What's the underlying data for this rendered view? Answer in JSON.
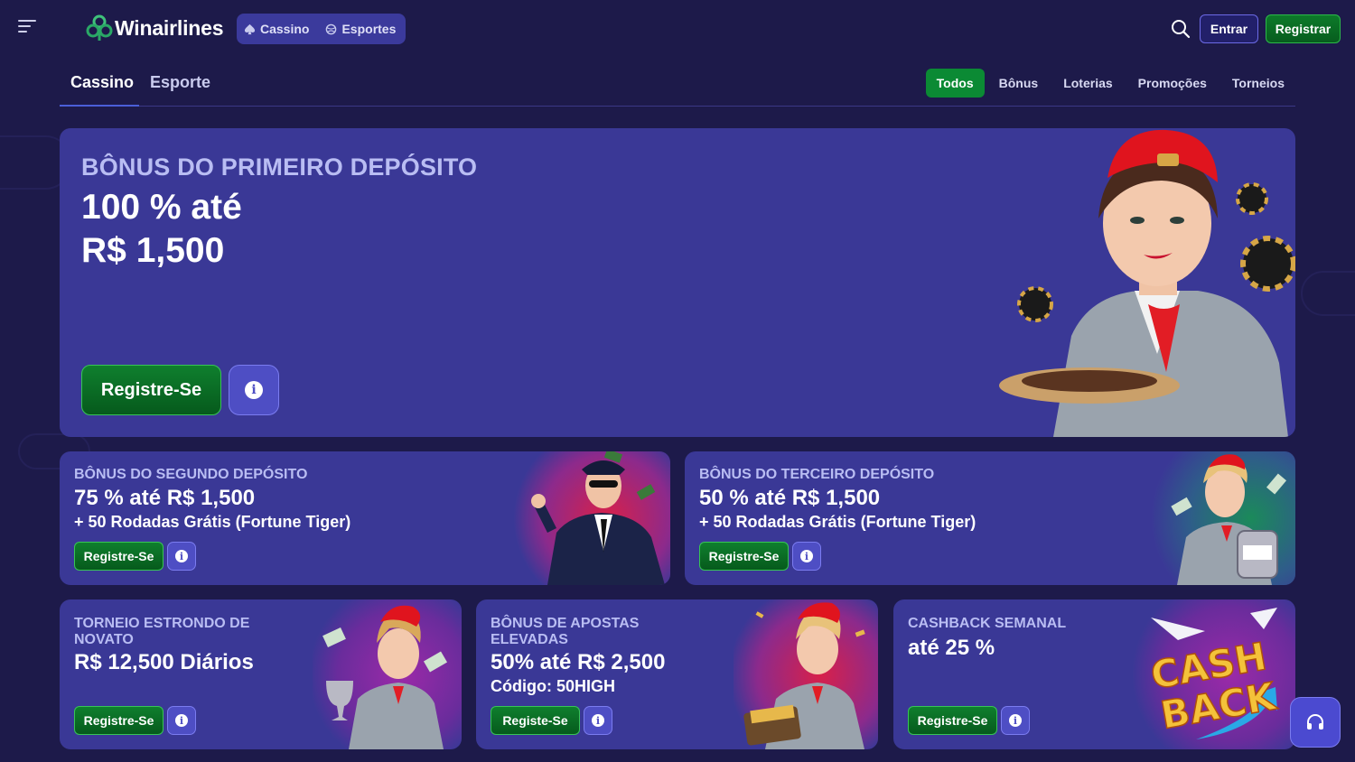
{
  "header": {
    "brand": "Winairlines",
    "products": [
      {
        "label": "Cassino",
        "icon": "spade-icon"
      },
      {
        "label": "Esportes",
        "icon": "ball-icon"
      }
    ],
    "login_label": "Entrar",
    "register_label": "Registrar"
  },
  "subnav": {
    "tabs": [
      "Cassino",
      "Esporte"
    ],
    "active_tab": "Cassino",
    "filters": [
      "Todos",
      "Bônus",
      "Loterias",
      "Promoções",
      "Torneios"
    ],
    "active_filter": "Todos"
  },
  "hero": {
    "eyebrow": "BÔNUS DO PRIMEIRO DEPÓSITO",
    "line1": "100 % até",
    "line2": "R$ 1,500",
    "cta": "Registre-Se"
  },
  "cards": [
    {
      "eyebrow": "BÔNUS DO SEGUNDO DEPÓSITO",
      "headline": "75 % até R$ 1,500",
      "sub": "+ 50 Rodadas Grátis (Fortune Tiger)",
      "cta": "Registre-Se"
    },
    {
      "eyebrow": "BÔNUS DO TERCEIRO DEPÓSITO",
      "headline": "50 % até R$ 1,500",
      "sub": "+ 50 Rodadas Grátis (Fortune Tiger)",
      "cta": "Registre-Se"
    },
    {
      "eyebrow": "TORNEIO ESTRONDO DE NOVATO",
      "headline": "R$ 12,500 Diários",
      "cta": "Registre-Se"
    },
    {
      "eyebrow": "BÔNUS DE APOSTAS ELEVADAS",
      "headline": "50% até R$ 2,500",
      "sub": "Código: 50HIGH",
      "cta": "Registe-Se"
    },
    {
      "eyebrow": "CASHBACK SEMANAL",
      "headline": "até 25 %",
      "cta": "Registre-Se",
      "art_line1": "CASH",
      "art_line2": "BACK"
    }
  ],
  "colors": {
    "background": "#1d1a4a",
    "card": "#3a3896",
    "accent_green": "#0b8a34",
    "eyebrow": "#b9bdf3"
  }
}
